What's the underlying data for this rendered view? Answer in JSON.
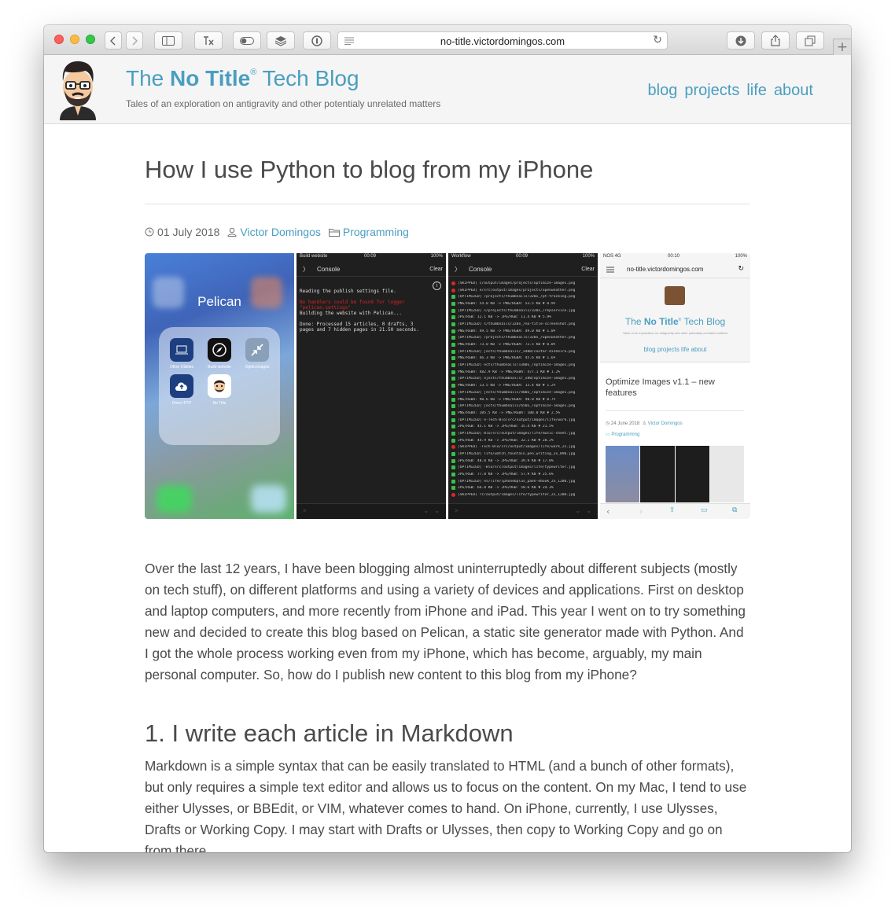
{
  "browser": {
    "url": "no-title.victordomingos.com"
  },
  "site": {
    "title_pre": "The ",
    "title_bold": "No Title",
    "title_reg": "®",
    "title_post": " Tech Blog",
    "tagline": "Tales of an exploration on antigravity and other potentialy unrelated matters",
    "nav": [
      "blog",
      "projects",
      "life",
      "about"
    ]
  },
  "post": {
    "title": "How I use Python to blog from my iPhone",
    "date": "01 July 2018",
    "author": "Victor Domingos",
    "category": "Programming",
    "intro": "Over the last 12 years, I have been blogging almost uninterruptedly about different subjects (mostly on tech stuff), on different platforms and using a variety of devices and applications. First on desktop and laptop computers, and more recently from iPhone and iPad. This year I went on to try something new and decided to create this blog based on Pelican, a static site generator made with Python. And I got the whole process working even from my iPhone, which has become, arguably, my main personal computer. So, how do I publish new content to this blog from my iPhone?",
    "section1_title": "1. I write each article in Markdown",
    "section1_body": "Markdown is a simple syntax that can be easily translated to HTML (and a bunch of other formats), but only requires a simple text editor and allows us to focus on the content. On my Mac, I tend to use either Ulysses, or BBEdit, or VIM, whatever comes to hand. On iPhone, currently, I use Ulysses, Drafts or Working Copy. I may start with Drafts or Ulysses, then copy to Working Copy and go on from there..."
  },
  "hero": {
    "shot1": {
      "folder": "Pelican",
      "apps": [
        "Other Utilities",
        "Build website",
        "Optim.images",
        "Direct FTP",
        "No Title"
      ]
    },
    "shot2": {
      "status_left": "Build website",
      "status_mid": "00:09",
      "status_right": "100%",
      "title": "Console",
      "clear": "Clear",
      "lines": [
        "Reading the publish settings file.",
        "",
        "No handlers could be found for logger",
        "\"pelican.settings\"",
        "Building the website with Pelican...",
        "",
        "Done: Processed 15 articles, 0 drafts, 3",
        "pages and 7 hidden pages in 21.50 seconds."
      ]
    },
    "shot3": {
      "status_left": "Workflow",
      "status_mid": "00:09",
      "status_right": "100%",
      "title": "Console",
      "clear": "Clear",
      "rows": [
        {
          "s": "skip",
          "t": "[SKIPPED] c/output/images/projects/optimize-images.png"
        },
        {
          "s": "skip",
          "t": "[SKIPPED] e/src/output/images/projects/openweather.png"
        },
        {
          "s": "ok",
          "t": "[OPTIMIZED] /projects/thumbnails/320x_/pt-tracking.png"
        },
        {
          "s": "ok",
          "t": "PNG/RGBA: 54.0 KB -> PNG/RGBA: 53.5 KB ▼ 0.9%"
        },
        {
          "s": "ok",
          "t": "[OPTIMIZED] s/projects/thumbnails/320x_/repservice.jpg"
        },
        {
          "s": "ok",
          "t": "JPG/RGB: 12.1 KB -> JPG/RGB: 11.4 KB ▼ 5.9%"
        },
        {
          "s": "ok",
          "t": "[OPTIMIZED] s/thumbnails/320x_/no-title-screenshot.png"
        },
        {
          "s": "ok",
          "t": "PNG/RGBA: 49.5 KB -> PNG/RGBA: 49.0 KB ▼ 1.0%"
        },
        {
          "s": "ok",
          "t": "[OPTIMIZED] /projects/thumbnails/320x_/openweather.png"
        },
        {
          "s": "ok",
          "t": "PNG/RGBA: 73.0 KB -> PNG/RGBA: 72.5 KB ▼ 0.8%"
        },
        {
          "s": "ok",
          "t": "[OPTIMIZED] jects/thumbnails/_x400/contar-dinheiro.png"
        },
        {
          "s": "ok",
          "t": "PNG/RGBA: 46.3 KB -> PNG/RGBA: 45.6 KB ▼ 1.6%"
        },
        {
          "s": "ok",
          "t": "[OPTIMIZED] ects/thumbnails/1380x_/optimize-images.png"
        },
        {
          "s": "ok",
          "t": "PNG/RGBA: 482.9 KB -> PNG/RGBA: 477.1 KB ▼ 1.2%"
        },
        {
          "s": "ok",
          "t": "[OPTIMIZED] ojects/thumbnails/_x80/optimize-images.png"
        },
        {
          "s": "ok",
          "t": "PNG/RGBA: 13.5 KB -> PNG/RGBA: 13.4 KB ▼ 1.2%"
        },
        {
          "s": "ok",
          "t": "[OPTIMIZED] jects/thumbnails/400x_/optimize-images.png"
        },
        {
          "s": "ok",
          "t": "PNG/RGBA: 90.6 KB -> PNG/RGBA: 90.0 KB ▼ 0.7%"
        },
        {
          "s": "ok",
          "t": "[OPTIMIZED] jects/thumbnails/650x_/optimize-images.png"
        },
        {
          "s": "ok",
          "t": "PNG/RGBA: 105.5 KB -> PNG/RGBA: 108.0 KB ▼ 2.5%"
        },
        {
          "s": "ok",
          "t": "[OPTIMIZED] e-Tech-Blo/src/output/images/life/work.jpg"
        },
        {
          "s": "ok",
          "t": "JPG/RGB: 45.1 KB -> JPG/RGB: 35.4 KB ▼ 21.5%"
        },
        {
          "s": "ok",
          "t": "[OPTIMIZED] Blo/src/output/images/life/music-sheet.jpg"
        },
        {
          "s": "ok",
          "t": "JPG/RGB: 44.9 KB -> JPG/RGB: 32.1 KB ▼ 28.2%"
        },
        {
          "s": "skip",
          "t": "[SKIPPED] -Tech-Blo/src/output/images/life/work_2x.jpg"
        },
        {
          "s": "ok",
          "t": "[OPTIMIZED] life/watch_fountain_pen_writing_2x_890.jpg"
        },
        {
          "s": "ok",
          "t": "JPG/RGB: 48.0 KB -> JPG/RGB: 39.9 KB ▼ 17.0%"
        },
        {
          "s": "ok",
          "t": "[OPTIMIZED] -Blo/src/output/images/life/typewriter.jpg"
        },
        {
          "s": "ok",
          "t": "JPG/RGB: 77.8 KB -> JPG/RGB: 57.9 KB ▼ 25.6%"
        },
        {
          "s": "ok",
          "t": "[OPTIMIZED] es/life/iphone6plus_paen-ebook_2x_1280.jpg"
        },
        {
          "s": "ok",
          "t": "JPG/RGB: 66.8 KB -> JPG/RGB: 50.6 KB ▼ 24.3%"
        },
        {
          "s": "skip",
          "t": "[SKIPPED] rc/output/images/life/typewriter_2x_1280.jpg"
        }
      ]
    },
    "shot4": {
      "status_left": "NOS 4G",
      "status_mid": "00:10",
      "status_right": "100%",
      "url": "no-title.victordomingos.com",
      "title_pre": "The ",
      "title_bold": "No Title",
      "title_reg": "®",
      "title_post": " Tech Blog",
      "tagline": "Tales of an exploration on antigravity and other potentialy unrelated matters",
      "nav": "blog  projects  life  about",
      "post_title": "Optimize Images v1.1 – new features",
      "date": "24 June 2018",
      "author": "Victor Domingos",
      "category": "Programming"
    }
  },
  "colors": {
    "accent": "#4a9ebf",
    "text": "#4a4a4a"
  }
}
